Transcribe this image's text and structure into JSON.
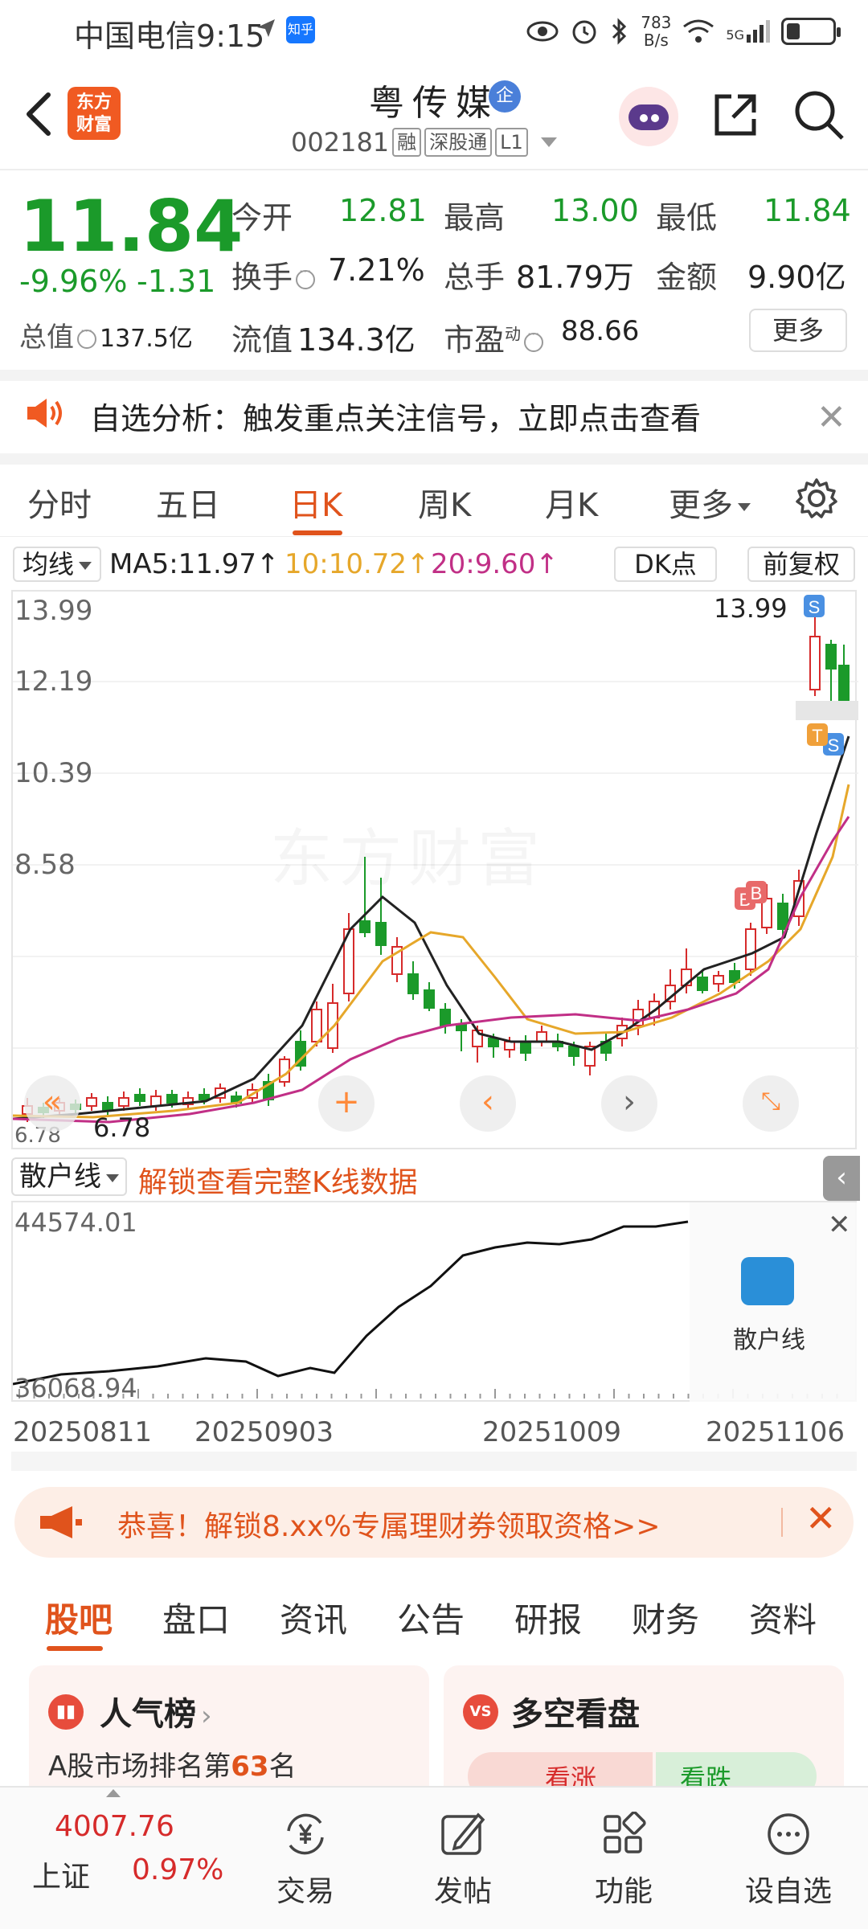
{
  "status_bar": {
    "carrier": "中国电信",
    "time": "9:15",
    "zhihu_badge": "知乎",
    "net_speed_value": "783",
    "net_speed_unit": "B/s",
    "signal_label": "5G"
  },
  "header": {
    "stock_name": "粤传媒",
    "qi_badge": "企",
    "stock_code": "002181",
    "tag_rong": "融",
    "tag_sgt": "深股通",
    "tag_l1": "L1",
    "logo_line1": "东方",
    "logo_line2": "财富"
  },
  "quote": {
    "price": "11.84",
    "change_pct": "-9.96%",
    "change_amt": "-1.31",
    "open_label": "今开",
    "open_value": "12.81",
    "high_label": "最高",
    "high_value": "13.00",
    "low_label": "最低",
    "low_value": "11.84",
    "turnover_label": "换手",
    "turnover_value": "7.21%",
    "volume_label": "总手",
    "volume_value": "81.79万",
    "amount_label": "金额",
    "amount_value": "9.90亿",
    "total_cap_label": "总值",
    "total_cap_value": "137.5亿",
    "float_cap_label": "流值",
    "float_cap_value": "134.3亿",
    "pe_label": "市盈",
    "pe_super": "动",
    "pe_value": "88.66",
    "more_button": "更多"
  },
  "notice": {
    "text": "自选分析：触发重点关注信号，立即点击查看"
  },
  "chart_tabs": {
    "items": [
      "分时",
      "五日",
      "日K",
      "周K",
      "月K",
      "更多"
    ],
    "active_index": 2
  },
  "ma_bar": {
    "selector": "均线",
    "ma5": "MA5:11.97↑",
    "ma10": "10:10.72↑",
    "ma20": "20:9.60↑",
    "dk_button": "DK点",
    "adjust_button": "前复权"
  },
  "kline": {
    "y_labels": [
      "13.99",
      "12.19",
      "10.39",
      "8.58",
      "6.78"
    ],
    "max_label": "13.99",
    "min_label": "6.78",
    "watermark": "东方财富",
    "marker_s": "S",
    "marker_b": "B",
    "marker_t": "T"
  },
  "chart_data": {
    "type": "line",
    "title": "",
    "y_range": [
      6.78,
      13.99
    ],
    "price_grid": [
      13.99,
      12.19,
      10.39,
      8.58,
      6.78
    ],
    "series": [
      {
        "name": "MA5",
        "color": "#222222",
        "last_value": 11.97
      },
      {
        "name": "MA10",
        "color": "#e6a72a",
        "last_value": 10.72
      },
      {
        "name": "MA20",
        "color": "#c12f86",
        "last_value": 9.6
      }
    ],
    "retail_line": {
      "y_range": [
        36068.94,
        44574.01
      ]
    },
    "x_labels": [
      "20250811",
      "20250903",
      "20251009",
      "20251106"
    ]
  },
  "retail": {
    "selector": "散户线",
    "unlock_text": "解锁查看完整K线数据",
    "max_label": "44574.01",
    "min_label": "36068.94",
    "overlay_label": "散户线"
  },
  "dates": [
    "20250811",
    "20250903",
    "20251009",
    "20251106"
  ],
  "promo": {
    "text": "恭喜！解锁8.xx%专属理财券领取资格>>"
  },
  "bottom_tabs": {
    "items": [
      "股吧",
      "盘口",
      "资讯",
      "公告",
      "研报",
      "财务",
      "资料"
    ],
    "active_index": 0
  },
  "cards": {
    "left_title": "人气榜",
    "left_sub_prefix": "A股市场排名第",
    "left_sub_rank": "63",
    "left_sub_suffix": "名",
    "right_title": "多空看盘",
    "right_icon": "VS",
    "bull_label": "看涨",
    "bear_label": "看跌"
  },
  "bottom_nav": {
    "index_value": "4007.76",
    "index_name": "上证",
    "index_change": "0.97%",
    "trade": "交易",
    "post": "发帖",
    "features": "功能",
    "add_watch": "设自选"
  },
  "colors": {
    "up": "#d62b2b",
    "down": "#1b9a2a",
    "accent": "#e0531c"
  }
}
